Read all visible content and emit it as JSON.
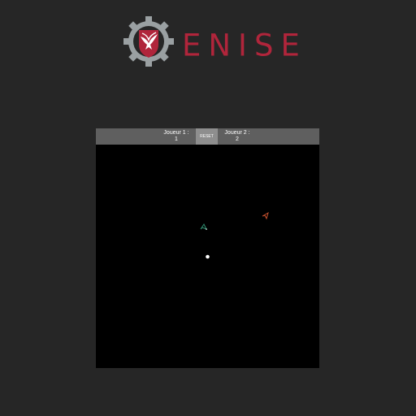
{
  "logo": {
    "text": "ENISE",
    "brand_color": "#b0253b",
    "gear_color": "#9aa0a2"
  },
  "game": {
    "background": "#000000",
    "scorebar": {
      "background": "#5f5f5f",
      "player1": {
        "label": "Joueur 1 :",
        "score": "1"
      },
      "reset_label": "RESET",
      "player2": {
        "label": "Joueur 2 :",
        "score": "2"
      }
    },
    "entities": {
      "ship_player1": {
        "icon": "ship-icon",
        "color": "#2e8b6e"
      },
      "ship_player2": {
        "icon": "ship-icon",
        "color": "#c8512e"
      },
      "ball": {
        "icon": "ball-icon",
        "color": "#ffffff"
      }
    }
  }
}
